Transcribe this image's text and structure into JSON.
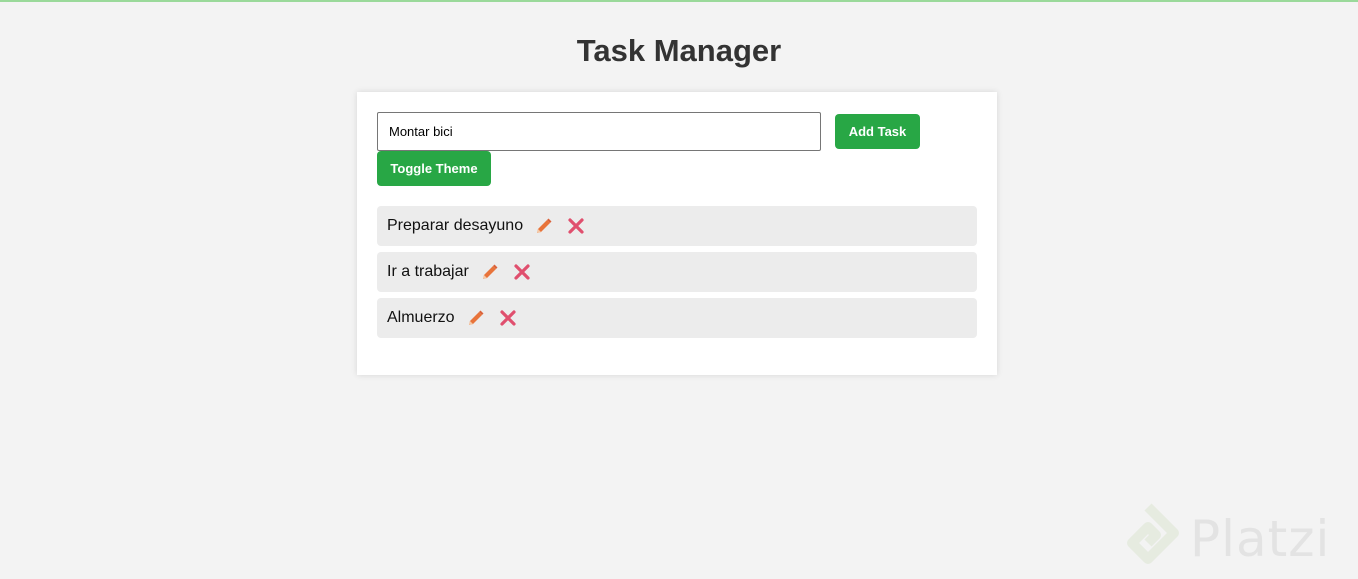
{
  "page": {
    "title": "Task Manager"
  },
  "form": {
    "input_value": "Montar bici",
    "add_label": "Add Task",
    "theme_label": "Toggle Theme"
  },
  "tasks": [
    {
      "text": "Preparar desayuno",
      "edit_icon": "pencil-icon",
      "delete_icon": "close-icon"
    },
    {
      "text": "Ir a trabajar",
      "edit_icon": "pencil-icon",
      "delete_icon": "close-icon"
    },
    {
      "text": "Almuerzo",
      "edit_icon": "pencil-icon",
      "delete_icon": "close-icon"
    }
  ],
  "watermark": {
    "text": "Platzi"
  },
  "colors": {
    "background": "#f3f3f3",
    "card": "#ffffff",
    "accent_green": "#28a745",
    "task_bg": "#ececec",
    "edit_orange": "#e8743b",
    "delete_pink": "#e04f6e"
  }
}
